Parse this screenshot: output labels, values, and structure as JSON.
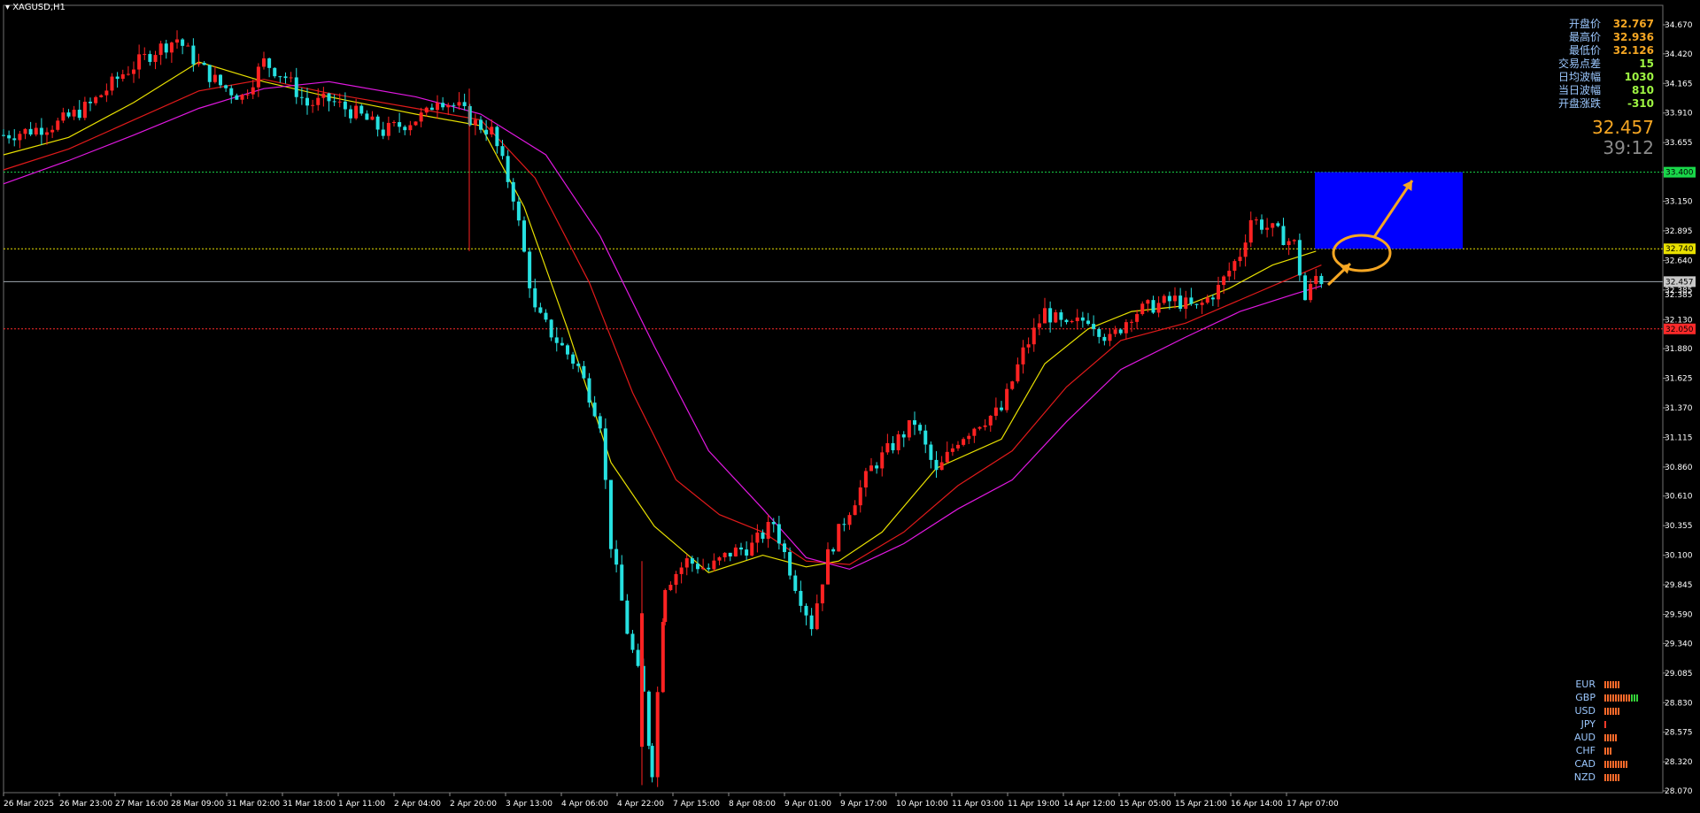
{
  "symbol": "XAGUSD,H1",
  "info_panel": {
    "rows": [
      {
        "label": "开盘价",
        "value": "32.767",
        "color": "#f5a623"
      },
      {
        "label": "最高价",
        "value": "32.936",
        "color": "#f5a623"
      },
      {
        "label": "最低价",
        "value": "32.126",
        "color": "#f5a623"
      },
      {
        "label": "交易点差",
        "value": "15",
        "color": "#9ef542"
      },
      {
        "label": "日均波幅",
        "value": "1030",
        "color": "#9ef542"
      },
      {
        "label": "当日波幅",
        "value": "810",
        "color": "#9ef542"
      },
      {
        "label": "开盘涨跌",
        "value": "-310",
        "color": "#9ef542"
      }
    ],
    "current_price": "32.457",
    "timer": "39:12"
  },
  "strength_meter": [
    {
      "label": "EUR",
      "level": 6,
      "color": "#ff6a2a"
    },
    {
      "label": "GBP",
      "level": 10,
      "color": "#ff6a2a",
      "extra_green": 3
    },
    {
      "label": "USD",
      "level": 6,
      "color": "#ff6a2a"
    },
    {
      "label": "JPY",
      "level": 1,
      "color": "#ff3b2a"
    },
    {
      "label": "AUD",
      "level": 5,
      "color": "#ff6a2a"
    },
    {
      "label": "CHF",
      "level": 3,
      "color": "#ff6a2a"
    },
    {
      "label": "CAD",
      "level": 9,
      "color": "#ff6a2a"
    },
    {
      "label": "NZD",
      "level": 6,
      "color": "#ff6a2a"
    }
  ],
  "chart_data": {
    "type": "candlestick",
    "price_axis": {
      "ticks": [
        "34.670",
        "34.420",
        "34.165",
        "33.910",
        "33.655",
        "33.400",
        "33.150",
        "32.895",
        "32.640",
        "32.385",
        "32.130",
        "31.880",
        "31.625",
        "31.370",
        "31.115",
        "30.860",
        "30.610",
        "30.355",
        "30.100",
        "29.845",
        "29.590",
        "29.340",
        "29.085",
        "28.830",
        "28.575",
        "28.320",
        "28.070"
      ],
      "min": 28.07,
      "max": 34.67
    },
    "time_axis": {
      "labels": [
        "26 Mar 2025",
        "26 Mar 23:00",
        "27 Mar 16:00",
        "28 Mar 09:00",
        "31 Mar 02:00",
        "31 Mar 18:00",
        "1 Apr 11:00",
        "2 Apr 04:00",
        "2 Apr 20:00",
        "3 Apr 13:00",
        "4 Apr 06:00",
        "4 Apr 22:00",
        "7 Apr 15:00",
        "8 Apr 08:00",
        "9 Apr 01:00",
        "9 Apr 17:00",
        "10 Apr 10:00",
        "11 Apr 03:00",
        "11 Apr 19:00",
        "14 Apr 12:00",
        "15 Apr 05:00",
        "15 Apr 21:00",
        "16 Apr 14:00",
        "17 Apr 07:00"
      ]
    },
    "horizontal_lines": [
      {
        "price": 33.4,
        "label": "33.400",
        "color": "#19d84a",
        "style": "dotted",
        "tag_bg": "#19d84a",
        "tag_text": "#000"
      },
      {
        "price": 32.74,
        "label": "32.740",
        "color": "#e8e000",
        "style": "dotted",
        "tag_bg": "#e8e000",
        "tag_text": "#000"
      },
      {
        "price": 32.457,
        "label": "32.457",
        "color": "#a0a8b0",
        "style": "solid",
        "tag_bg": "#c8c8c8",
        "tag_text": "#000"
      },
      {
        "price": 32.05,
        "label": "32.050",
        "color": "#ff2a2a",
        "style": "dotted",
        "tag_bg": "#ff2a2a",
        "tag_text": "#000"
      }
    ],
    "extra_axis_label": "32.385",
    "target_zone": {
      "price_top": 33.4,
      "price_bottom": 32.74,
      "color": "#0000ff"
    },
    "key_points": [
      [
        0,
        33.72
      ],
      [
        20,
        33.75
      ],
      [
        50,
        33.82
      ],
      [
        80,
        33.98
      ],
      [
        110,
        34.25
      ],
      [
        140,
        34.45
      ],
      [
        160,
        34.55
      ],
      [
        180,
        34.32
      ],
      [
        200,
        34.15
      ],
      [
        220,
        34.05
      ],
      [
        240,
        34.35
      ],
      [
        260,
        34.22
      ],
      [
        280,
        33.98
      ],
      [
        300,
        34.02
      ],
      [
        330,
        33.88
      ],
      [
        350,
        33.75
      ],
      [
        370,
        33.82
      ],
      [
        390,
        33.9
      ],
      [
        400,
        34.05
      ],
      [
        420,
        33.95
      ],
      [
        435,
        33.82
      ],
      [
        450,
        33.75
      ],
      [
        470,
        33.2
      ],
      [
        490,
        32.2
      ],
      [
        510,
        31.95
      ],
      [
        530,
        31.72
      ],
      [
        550,
        31.25
      ],
      [
        560,
        30.2
      ],
      [
        575,
        29.45
      ],
      [
        590,
        28.9
      ],
      [
        598,
        28.25
      ],
      [
        610,
        29.85
      ],
      [
        630,
        30.05
      ],
      [
        650,
        29.98
      ],
      [
        670,
        30.12
      ],
      [
        690,
        30.18
      ],
      [
        710,
        30.38
      ],
      [
        730,
        29.85
      ],
      [
        745,
        29.5
      ],
      [
        760,
        30.1
      ],
      [
        780,
        30.5
      ],
      [
        800,
        30.85
      ],
      [
        820,
        31.05
      ],
      [
        840,
        31.25
      ],
      [
        860,
        30.8
      ],
      [
        880,
        31.1
      ],
      [
        900,
        31.25
      ],
      [
        920,
        31.35
      ],
      [
        940,
        31.85
      ],
      [
        960,
        32.2
      ],
      [
        980,
        32.05
      ],
      [
        1000,
        32.15
      ],
      [
        1020,
        31.95
      ],
      [
        1040,
        32.18
      ],
      [
        1060,
        32.25
      ],
      [
        1080,
        32.3
      ],
      [
        1100,
        32.22
      ],
      [
        1120,
        32.4
      ],
      [
        1140,
        32.7
      ],
      [
        1150,
        33.0
      ],
      [
        1170,
        32.9
      ],
      [
        1190,
        32.78
      ],
      [
        1200,
        32.3
      ],
      [
        1210,
        32.5
      ],
      [
        1218,
        32.457
      ]
    ],
    "moving_averages": [
      {
        "color": "#e8e000",
        "points": [
          [
            0,
            33.55
          ],
          [
            60,
            33.7
          ],
          [
            120,
            34.0
          ],
          [
            180,
            34.35
          ],
          [
            240,
            34.18
          ],
          [
            300,
            34.05
          ],
          [
            380,
            33.9
          ],
          [
            440,
            33.8
          ],
          [
            480,
            33.1
          ],
          [
            520,
            32.05
          ],
          [
            560,
            30.9
          ],
          [
            600,
            30.35
          ],
          [
            650,
            29.95
          ],
          [
            700,
            30.1
          ],
          [
            740,
            30.0
          ],
          [
            770,
            30.05
          ],
          [
            810,
            30.3
          ],
          [
            860,
            30.85
          ],
          [
            920,
            31.1
          ],
          [
            960,
            31.75
          ],
          [
            1000,
            32.05
          ],
          [
            1040,
            32.2
          ],
          [
            1090,
            32.25
          ],
          [
            1130,
            32.4
          ],
          [
            1170,
            32.6
          ],
          [
            1210,
            32.72
          ]
        ]
      },
      {
        "color": "#e01a1a",
        "points": [
          [
            0,
            33.42
          ],
          [
            60,
            33.6
          ],
          [
            120,
            33.85
          ],
          [
            180,
            34.1
          ],
          [
            240,
            34.2
          ],
          [
            300,
            34.08
          ],
          [
            380,
            33.95
          ],
          [
            440,
            33.85
          ],
          [
            490,
            33.35
          ],
          [
            540,
            32.45
          ],
          [
            580,
            31.5
          ],
          [
            620,
            30.75
          ],
          [
            660,
            30.45
          ],
          [
            700,
            30.3
          ],
          [
            740,
            30.05
          ],
          [
            780,
            30.02
          ],
          [
            830,
            30.3
          ],
          [
            880,
            30.7
          ],
          [
            930,
            31.0
          ],
          [
            980,
            31.55
          ],
          [
            1030,
            31.95
          ],
          [
            1090,
            32.1
          ],
          [
            1140,
            32.3
          ],
          [
            1190,
            32.5
          ],
          [
            1215,
            32.6
          ]
        ]
      },
      {
        "color": "#e018e0",
        "points": [
          [
            0,
            33.3
          ],
          [
            60,
            33.5
          ],
          [
            120,
            33.72
          ],
          [
            180,
            33.95
          ],
          [
            240,
            34.12
          ],
          [
            300,
            34.18
          ],
          [
            380,
            34.05
          ],
          [
            440,
            33.9
          ],
          [
            500,
            33.55
          ],
          [
            550,
            32.85
          ],
          [
            600,
            31.9
          ],
          [
            650,
            31.0
          ],
          [
            700,
            30.5
          ],
          [
            740,
            30.08
          ],
          [
            780,
            29.98
          ],
          [
            830,
            30.2
          ],
          [
            880,
            30.5
          ],
          [
            930,
            30.75
          ],
          [
            980,
            31.25
          ],
          [
            1030,
            31.7
          ],
          [
            1090,
            31.98
          ],
          [
            1140,
            32.2
          ],
          [
            1190,
            32.35
          ],
          [
            1215,
            32.42
          ]
        ]
      }
    ]
  }
}
